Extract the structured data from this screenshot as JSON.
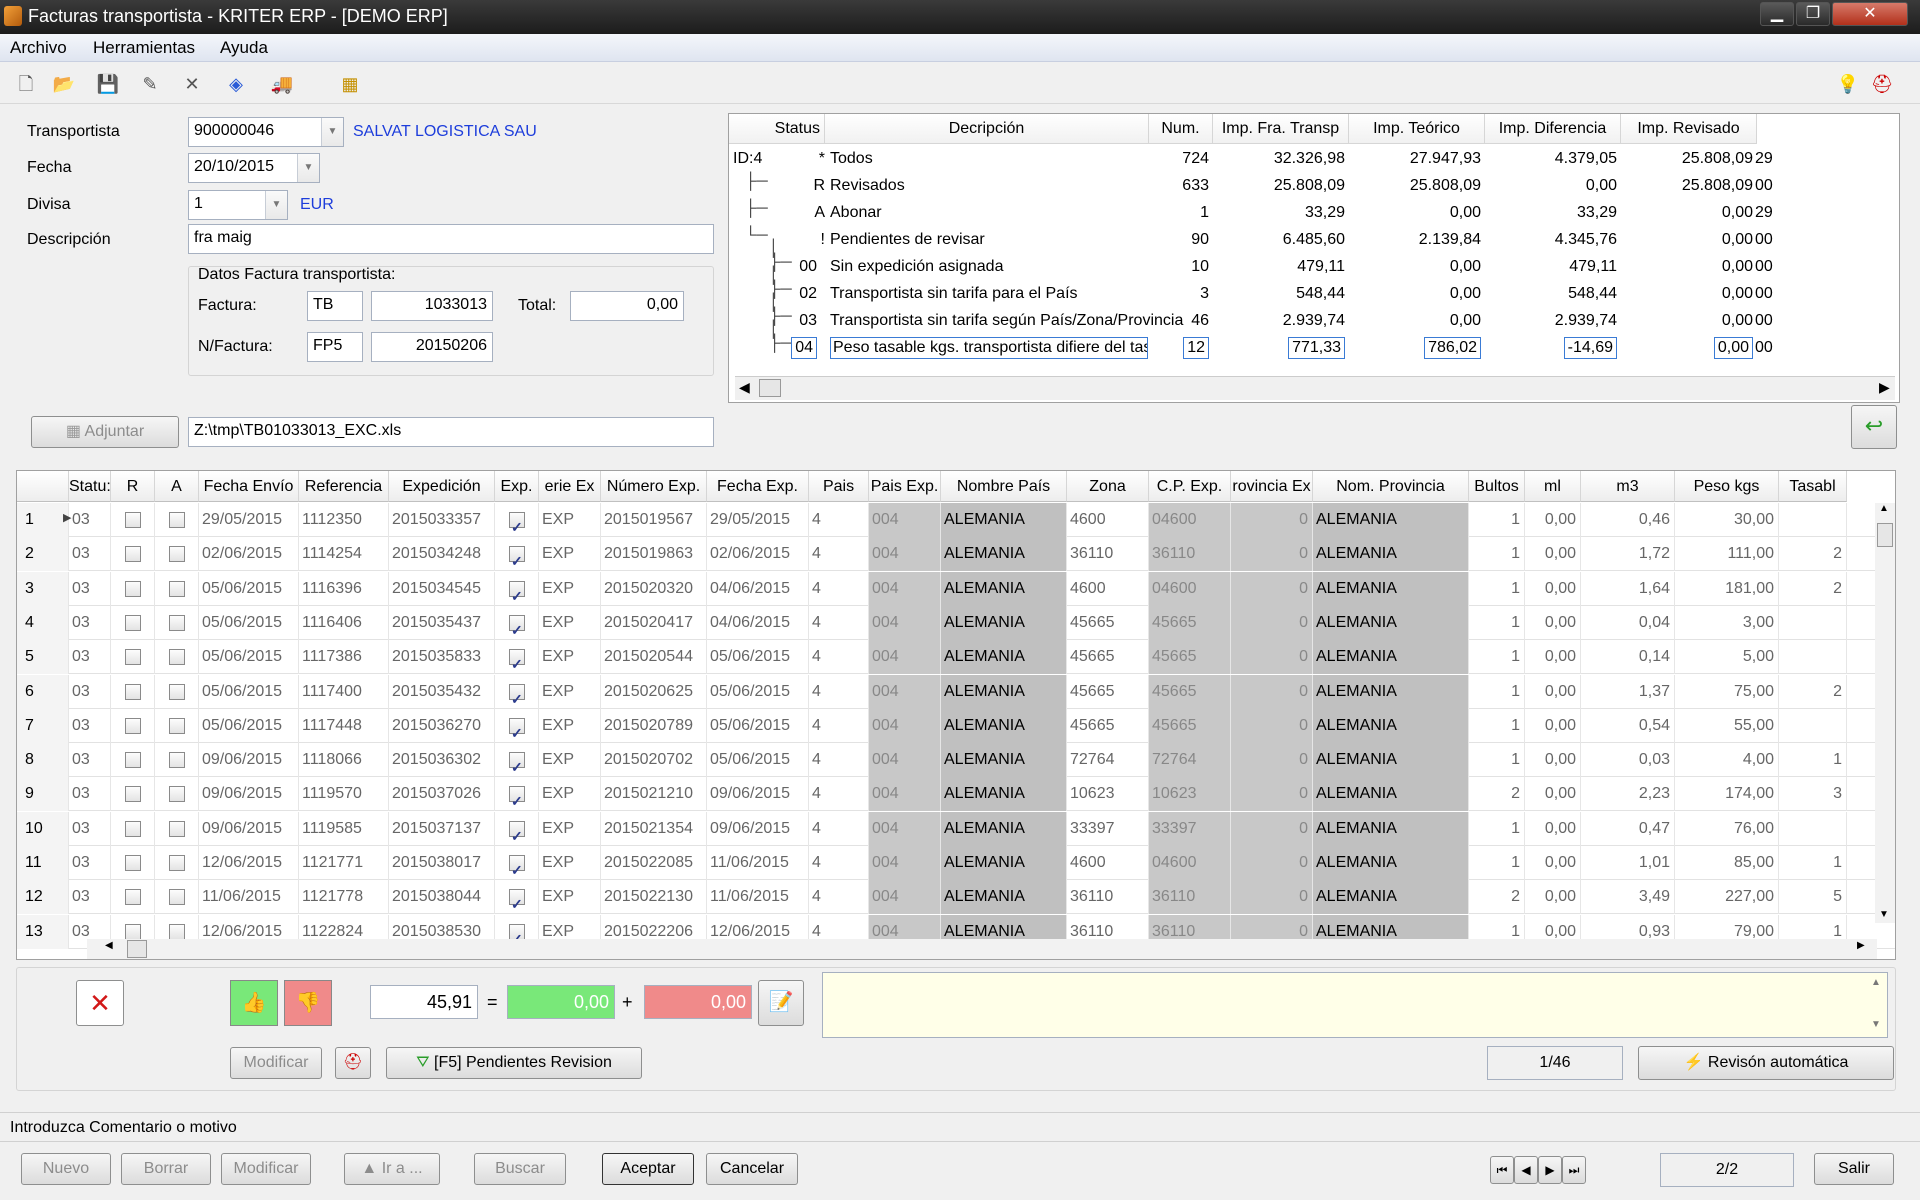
{
  "window": {
    "title": "Facturas transportista - KRITER ERP - [DEMO ERP]",
    "min": "▁",
    "max": "❐",
    "close": "✕"
  },
  "menu": [
    "Archivo",
    "Herramientas",
    "Ayuda"
  ],
  "form": {
    "transportista_label": "Transportista",
    "transportista_code": "900000046",
    "transportista_name": "SALVAT LOGISTICA SAU",
    "fecha_label": "Fecha",
    "fecha": "20/10/2015",
    "divisa_label": "Divisa",
    "divisa": "1",
    "divisa_name": "EUR",
    "descripcion_label": "Descripción",
    "descripcion": "fra maig",
    "group_title": "Datos Factura transportista:",
    "factura_label": "Factura:",
    "factura_serie": "TB",
    "factura_num": "1033013",
    "total_label": "Total:",
    "total": "0,00",
    "nfactura_label": "N/Factura:",
    "nfactura_serie": "FP5",
    "nfactura_num": "20150206",
    "adjuntar": "Adjuntar",
    "file_path": "Z:\\tmp\\TB01033013_EXC.xls"
  },
  "tree": {
    "headers": [
      "Status",
      "Decripción",
      "Num.",
      "Imp. Fra. Transp",
      "Imp. Teórico",
      "Imp. Diferencia",
      "Imp. Revisado"
    ],
    "root": "ID:4",
    "rows": [
      {
        "status": "*",
        "desc": "Todos",
        "num": "724",
        "fra": "32.326,98",
        "teo": "27.947,93",
        "dif": "4.379,05",
        "rev": "25.808,09",
        "tail": "29"
      },
      {
        "status": "R",
        "desc": "Revisados",
        "num": "633",
        "fra": "25.808,09",
        "teo": "25.808,09",
        "dif": "0,00",
        "rev": "25.808,09",
        "tail": "00"
      },
      {
        "status": "A",
        "desc": "Abonar",
        "num": "1",
        "fra": "33,29",
        "teo": "0,00",
        "dif": "33,29",
        "rev": "0,00",
        "tail": "29"
      },
      {
        "status": "!",
        "desc": "Pendientes de revisar",
        "num": "90",
        "fra": "6.485,60",
        "teo": "2.139,84",
        "dif": "4.345,76",
        "rev": "0,00",
        "tail": "00"
      },
      {
        "status": "00",
        "desc": "Sin expedición asignada",
        "num": "10",
        "fra": "479,11",
        "teo": "0,00",
        "dif": "479,11",
        "rev": "0,00",
        "tail": "00"
      },
      {
        "status": "02",
        "desc": "Transportista sin tarifa para el País",
        "num": "3",
        "fra": "548,44",
        "teo": "0,00",
        "dif": "548,44",
        "rev": "0,00",
        "tail": "00"
      },
      {
        "status": "03",
        "desc": "Transportista sin tarifa según País/Zona/Provincia",
        "num": "46",
        "fra": "2.939,74",
        "teo": "0,00",
        "dif": "2.939,74",
        "rev": "0,00",
        "tail": "00"
      },
      {
        "status": "04",
        "desc": "Peso tasable kgs. transportista difiere del tasable teórico calcul",
        "num": "12",
        "fra": "771,33",
        "teo": "786,02",
        "dif": "-14,69",
        "rev": "0,00",
        "tail": "00"
      }
    ]
  },
  "grid": {
    "headers": [
      "Statu:",
      "R",
      "A",
      "Fecha Envío",
      "Referencia",
      "Expedición",
      "Exp.",
      "erie Ex",
      "Número Exp.",
      "Fecha Exp.",
      "Pais",
      "Pais Exp.",
      "Nombre País",
      "Zona",
      "C.P. Exp.",
      "rovincia Ex",
      "Nom. Provincia",
      "Bultos",
      "ml",
      "m3",
      "Peso kgs",
      "Tasabl"
    ],
    "rows": [
      {
        "n": "1",
        "st": "03",
        "fe": "29/05/2015",
        "ref": "1112350",
        "exp": "2015033357",
        "se": "EXP",
        "ne": "2015019567",
        "fx": "29/05/2015",
        "p": "4",
        "pe": "004",
        "np": "ALEMANIA",
        "z": "4600",
        "cp": "04600",
        "pr": "0",
        "npr": "ALEMANIA",
        "b": "1",
        "ml": "0,00",
        "m3": "0,46",
        "kg": "30,00",
        "t": ""
      },
      {
        "n": "2",
        "st": "03",
        "fe": "02/06/2015",
        "ref": "1114254",
        "exp": "2015034248",
        "se": "EXP",
        "ne": "2015019863",
        "fx": "02/06/2015",
        "p": "4",
        "pe": "004",
        "np": "ALEMANIA",
        "z": "36110",
        "cp": "36110",
        "pr": "0",
        "npr": "ALEMANIA",
        "b": "1",
        "ml": "0,00",
        "m3": "1,72",
        "kg": "111,00",
        "t": "2"
      },
      {
        "n": "3",
        "st": "03",
        "fe": "05/06/2015",
        "ref": "1116396",
        "exp": "2015034545",
        "se": "EXP",
        "ne": "2015020320",
        "fx": "04/06/2015",
        "p": "4",
        "pe": "004",
        "np": "ALEMANIA",
        "z": "4600",
        "cp": "04600",
        "pr": "0",
        "npr": "ALEMANIA",
        "b": "1",
        "ml": "0,00",
        "m3": "1,64",
        "kg": "181,00",
        "t": "2"
      },
      {
        "n": "4",
        "st": "03",
        "fe": "05/06/2015",
        "ref": "1116406",
        "exp": "2015035437",
        "se": "EXP",
        "ne": "2015020417",
        "fx": "04/06/2015",
        "p": "4",
        "pe": "004",
        "np": "ALEMANIA",
        "z": "45665",
        "cp": "45665",
        "pr": "0",
        "npr": "ALEMANIA",
        "b": "1",
        "ml": "0,00",
        "m3": "0,04",
        "kg": "3,00",
        "t": ""
      },
      {
        "n": "5",
        "st": "03",
        "fe": "05/06/2015",
        "ref": "1117386",
        "exp": "2015035833",
        "se": "EXP",
        "ne": "2015020544",
        "fx": "05/06/2015",
        "p": "4",
        "pe": "004",
        "np": "ALEMANIA",
        "z": "45665",
        "cp": "45665",
        "pr": "0",
        "npr": "ALEMANIA",
        "b": "1",
        "ml": "0,00",
        "m3": "0,14",
        "kg": "5,00",
        "t": ""
      },
      {
        "n": "6",
        "st": "03",
        "fe": "05/06/2015",
        "ref": "1117400",
        "exp": "2015035432",
        "se": "EXP",
        "ne": "2015020625",
        "fx": "05/06/2015",
        "p": "4",
        "pe": "004",
        "np": "ALEMANIA",
        "z": "45665",
        "cp": "45665",
        "pr": "0",
        "npr": "ALEMANIA",
        "b": "1",
        "ml": "0,00",
        "m3": "1,37",
        "kg": "75,00",
        "t": "2"
      },
      {
        "n": "7",
        "st": "03",
        "fe": "05/06/2015",
        "ref": "1117448",
        "exp": "2015036270",
        "se": "EXP",
        "ne": "2015020789",
        "fx": "05/06/2015",
        "p": "4",
        "pe": "004",
        "np": "ALEMANIA",
        "z": "45665",
        "cp": "45665",
        "pr": "0",
        "npr": "ALEMANIA",
        "b": "1",
        "ml": "0,00",
        "m3": "0,54",
        "kg": "55,00",
        "t": ""
      },
      {
        "n": "8",
        "st": "03",
        "fe": "09/06/2015",
        "ref": "1118066",
        "exp": "2015036302",
        "se": "EXP",
        "ne": "2015020702",
        "fx": "05/06/2015",
        "p": "4",
        "pe": "004",
        "np": "ALEMANIA",
        "z": "72764",
        "cp": "72764",
        "pr": "0",
        "npr": "ALEMANIA",
        "b": "1",
        "ml": "0,00",
        "m3": "0,03",
        "kg": "4,00",
        "t": "1"
      },
      {
        "n": "9",
        "st": "03",
        "fe": "09/06/2015",
        "ref": "1119570",
        "exp": "2015037026",
        "se": "EXP",
        "ne": "2015021210",
        "fx": "09/06/2015",
        "p": "4",
        "pe": "004",
        "np": "ALEMANIA",
        "z": "10623",
        "cp": "10623",
        "pr": "0",
        "npr": "ALEMANIA",
        "b": "2",
        "ml": "0,00",
        "m3": "2,23",
        "kg": "174,00",
        "t": "3"
      },
      {
        "n": "10",
        "st": "03",
        "fe": "09/06/2015",
        "ref": "1119585",
        "exp": "2015037137",
        "se": "EXP",
        "ne": "2015021354",
        "fx": "09/06/2015",
        "p": "4",
        "pe": "004",
        "np": "ALEMANIA",
        "z": "33397",
        "cp": "33397",
        "pr": "0",
        "npr": "ALEMANIA",
        "b": "1",
        "ml": "0,00",
        "m3": "0,47",
        "kg": "76,00",
        "t": ""
      },
      {
        "n": "11",
        "st": "03",
        "fe": "12/06/2015",
        "ref": "1121771",
        "exp": "2015038017",
        "se": "EXP",
        "ne": "2015022085",
        "fx": "11/06/2015",
        "p": "4",
        "pe": "004",
        "np": "ALEMANIA",
        "z": "4600",
        "cp": "04600",
        "pr": "0",
        "npr": "ALEMANIA",
        "b": "1",
        "ml": "0,00",
        "m3": "1,01",
        "kg": "85,00",
        "t": "1"
      },
      {
        "n": "12",
        "st": "03",
        "fe": "11/06/2015",
        "ref": "1121778",
        "exp": "2015038044",
        "se": "EXP",
        "ne": "2015022130",
        "fx": "11/06/2015",
        "p": "4",
        "pe": "004",
        "np": "ALEMANIA",
        "z": "36110",
        "cp": "36110",
        "pr": "0",
        "npr": "ALEMANIA",
        "b": "2",
        "ml": "0,00",
        "m3": "3,49",
        "kg": "227,00",
        "t": "5"
      },
      {
        "n": "13",
        "st": "03",
        "fe": "12/06/2015",
        "ref": "1122824",
        "exp": "2015038530",
        "se": "EXP",
        "ne": "2015022206",
        "fx": "12/06/2015",
        "p": "4",
        "pe": "004",
        "np": "ALEMANIA",
        "z": "36110",
        "cp": "36110",
        "pr": "0",
        "npr": "ALEMANIA",
        "b": "1",
        "ml": "0,00",
        "m3": "0,93",
        "kg": "79,00",
        "t": "1"
      }
    ]
  },
  "calc": {
    "total": "45,91",
    "eq": "=",
    "green": "0,00",
    "plus": "+",
    "red": "0,00"
  },
  "actions": {
    "modificar": "Modificar",
    "pendientes": "[F5] Pendientes Revision",
    "counter": "1/46",
    "revision": "Revisón automática"
  },
  "status": "Introduzca Comentario o motivo",
  "footer": {
    "nuevo": "Nuevo",
    "borrar": "Borrar",
    "modificar": "Modificar",
    "ira": "Ir a ...",
    "buscar": "Buscar",
    "aceptar": "Aceptar",
    "cancelar": "Cancelar",
    "record": "2/2",
    "salir": "Salir"
  },
  "colors": {
    "green": "#79e879",
    "red": "#f08a8a",
    "comment_bg": "#ffffe8",
    "link": "#1d3ddb"
  }
}
